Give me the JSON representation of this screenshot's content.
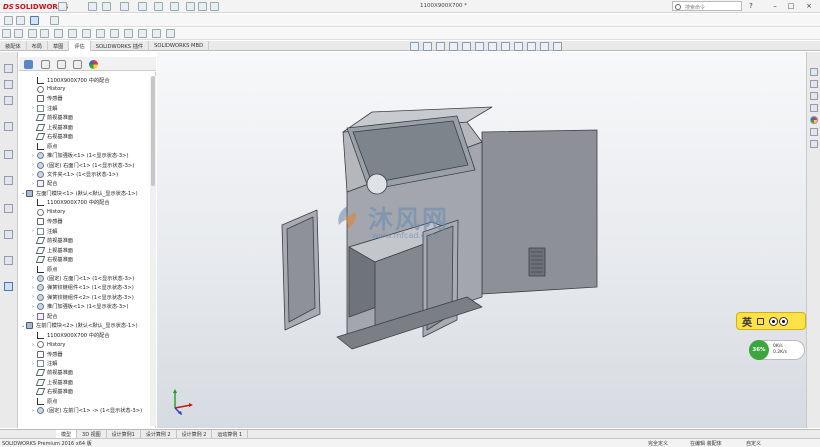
{
  "app": {
    "brand_prefix": "DS",
    "brand_name": "SOLIDWORKS"
  },
  "window": {
    "doc_title": "1100X900X700 *",
    "search_placeholder": "搜索命令",
    "minimize": "–",
    "maximize": "□",
    "close": "×"
  },
  "command_tabs": [
    "装配体",
    "布局",
    "草图",
    "评估",
    "SOLIDWORKS 插件",
    "SOLIDWORKS MBD"
  ],
  "command_tabs_active": 3,
  "tree": [
    {
      "indent": 0,
      "arrow": "",
      "icon": "origin",
      "label": "1100X900X700 中的配合"
    },
    {
      "indent": 0,
      "arrow": "",
      "icon": "hist",
      "label": "History"
    },
    {
      "indent": 0,
      "arrow": "",
      "icon": "sensor",
      "label": "传感器"
    },
    {
      "indent": 0,
      "arrow": "›",
      "icon": "note",
      "label": "注解"
    },
    {
      "indent": 0,
      "arrow": "",
      "icon": "plane",
      "label": "前视基准面"
    },
    {
      "indent": 0,
      "arrow": "",
      "icon": "plane",
      "label": "上视基准面"
    },
    {
      "indent": 0,
      "arrow": "",
      "icon": "plane",
      "label": "右视基准面"
    },
    {
      "indent": 0,
      "arrow": "",
      "icon": "origin",
      "label": "原点"
    },
    {
      "indent": 0,
      "arrow": "›",
      "icon": "part",
      "label": "推门加强板<1> (1<显示状态-3>)"
    },
    {
      "indent": 0,
      "arrow": "›",
      "icon": "part",
      "label": "(固定) 右面门<1> (1<显示状态-3>)"
    },
    {
      "indent": 0,
      "arrow": "›",
      "icon": "part",
      "label": "文件夹<1> (1<显示状态-1>)"
    },
    {
      "indent": 0,
      "arrow": "›",
      "icon": "mate",
      "label": "配合"
    },
    {
      "indent": -1,
      "arrow": "⌄",
      "icon": "asm",
      "label": "左面门模块<1> (默认<默认_显示状态-1>)"
    },
    {
      "indent": 0,
      "arrow": "",
      "icon": "origin",
      "label": "1100X900X700 中的配合"
    },
    {
      "indent": 0,
      "arrow": "",
      "icon": "hist",
      "label": "History"
    },
    {
      "indent": 0,
      "arrow": "",
      "icon": "sensor",
      "label": "传感器"
    },
    {
      "indent": 0,
      "arrow": "›",
      "icon": "note",
      "label": "注解"
    },
    {
      "indent": 0,
      "arrow": "",
      "icon": "plane",
      "label": "前视基准面"
    },
    {
      "indent": 0,
      "arrow": "",
      "icon": "plane",
      "label": "上视基准面"
    },
    {
      "indent": 0,
      "arrow": "",
      "icon": "plane",
      "label": "右视基准面"
    },
    {
      "indent": 0,
      "arrow": "",
      "icon": "origin",
      "label": "原点"
    },
    {
      "indent": 0,
      "arrow": "›",
      "icon": "part",
      "label": "(固定) 左面门<1> (1<显示状态-3>)"
    },
    {
      "indent": 0,
      "arrow": "›",
      "icon": "part",
      "label": "弹簧铰链组件<1> (1<显示状态-3>)"
    },
    {
      "indent": 0,
      "arrow": "›",
      "icon": "part",
      "label": "弹簧铰链组件<2> (1<显示状态-3>)"
    },
    {
      "indent": 0,
      "arrow": "›",
      "icon": "part",
      "label": "推门加强板<1> (1<显示状态-3>)"
    },
    {
      "indent": 0,
      "arrow": "›",
      "icon": "mate",
      "label": "配合"
    },
    {
      "indent": -1,
      "arrow": "⌄",
      "icon": "asm",
      "label": "左前门模块<2> (默认<默认_显示状态-1>)"
    },
    {
      "indent": 0,
      "arrow": "",
      "icon": "origin",
      "label": "1100X900X700 中的配合"
    },
    {
      "indent": 0,
      "arrow": "›",
      "icon": "hist",
      "label": "History"
    },
    {
      "indent": 0,
      "arrow": "",
      "icon": "sensor",
      "label": "传感器"
    },
    {
      "indent": 0,
      "arrow": "›",
      "icon": "note",
      "label": "注解"
    },
    {
      "indent": 0,
      "arrow": "",
      "icon": "plane",
      "label": "前视基准面"
    },
    {
      "indent": 0,
      "arrow": "",
      "icon": "plane",
      "label": "上视基准面"
    },
    {
      "indent": 0,
      "arrow": "",
      "icon": "plane",
      "label": "右视基准面"
    },
    {
      "indent": 0,
      "arrow": "",
      "icon": "origin",
      "label": "原点"
    },
    {
      "indent": 0,
      "arrow": "›",
      "icon": "part",
      "label": "(固定) 左前门<1> -> (1<显示状态-3>)"
    }
  ],
  "watermark": {
    "text": "沐风网",
    "url": "www.mfcad.com"
  },
  "ime": {
    "lang": "英"
  },
  "netmon": {
    "percent": "36%",
    "up": "0K/s",
    "down": "0.2K/s"
  },
  "bottom_tabs": [
    "模型",
    "3D 视图",
    "设计算例1",
    "设计算例 2",
    "设计算例 2",
    "运动算例 1"
  ],
  "bottom_tabs_active": 0,
  "status": {
    "left": "SOLIDWORKS Premium 2016 x64 版",
    "s1": "完全定义",
    "s2": "在编辑 装配体",
    "s3": "自定义"
  },
  "colors": {
    "accent": "#d0121b",
    "viewport_top": "#f7f8fa",
    "viewport_bottom": "#d6dbe1",
    "model": "#8e9298"
  }
}
